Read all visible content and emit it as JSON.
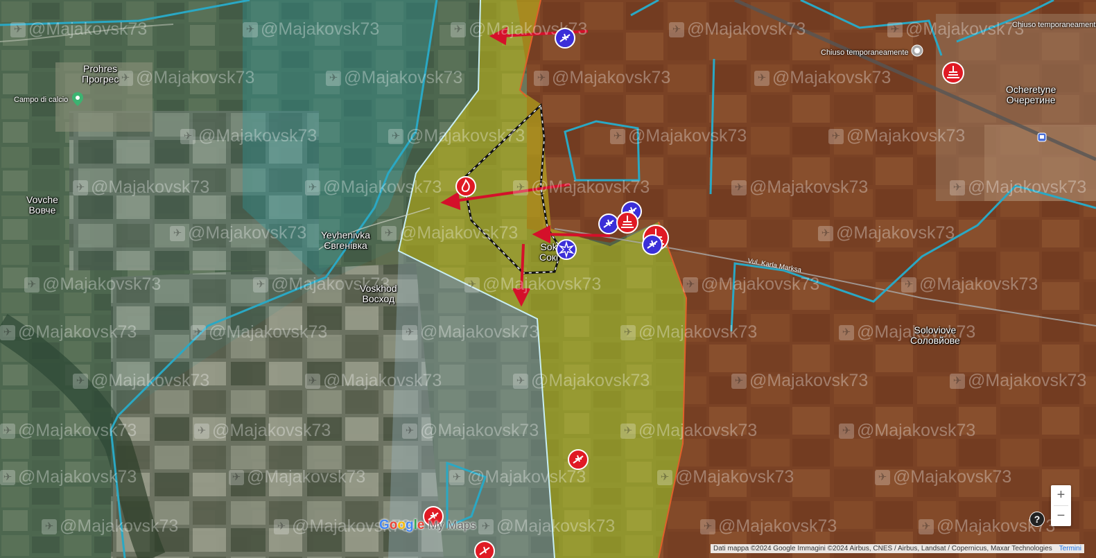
{
  "places": {
    "prohres": {
      "en": "Prohres",
      "cy": "Прогрес"
    },
    "vovche": {
      "en": "Vovche",
      "cy": "Вовче"
    },
    "yevhenivka": {
      "en": "Yevhenivka",
      "cy": "Євгенівка"
    },
    "voskhod": {
      "en": "Voskhod",
      "cy": "Восход"
    },
    "sokil": {
      "en": "Sok",
      "cy": "Сокі"
    },
    "ocheretyne": {
      "en": "Ocheretyne",
      "cy": "Очеретине"
    },
    "soloviove": {
      "en": "Soloviove",
      "cy": "Соловйове"
    }
  },
  "labels": {
    "campo": "Campo di calcio",
    "chiuso1": "Chiuso temporaneamente",
    "chiuso2": "Chiuso temporaneamente",
    "road": "Vul. Karla Marksa"
  },
  "watermark": "@Majakovsk73",
  "controls": {
    "zoom_in": "+",
    "zoom_out": "−",
    "help": "?"
  },
  "attribution": {
    "text": "Dati mappa ©2024 Google Immagini ©2024 Airbus, CNES / Airbus, Landsat / Copernicus, Maxar Technologies",
    "terms": "Termini"
  },
  "logo": {
    "google": "Google",
    "mymaps": "My Maps"
  },
  "colors": {
    "russian_controlled": "#8a4a2a",
    "contested": "#b8b820",
    "ukrainian_held": "#2f8fa8",
    "arrow": "#e0102a"
  }
}
